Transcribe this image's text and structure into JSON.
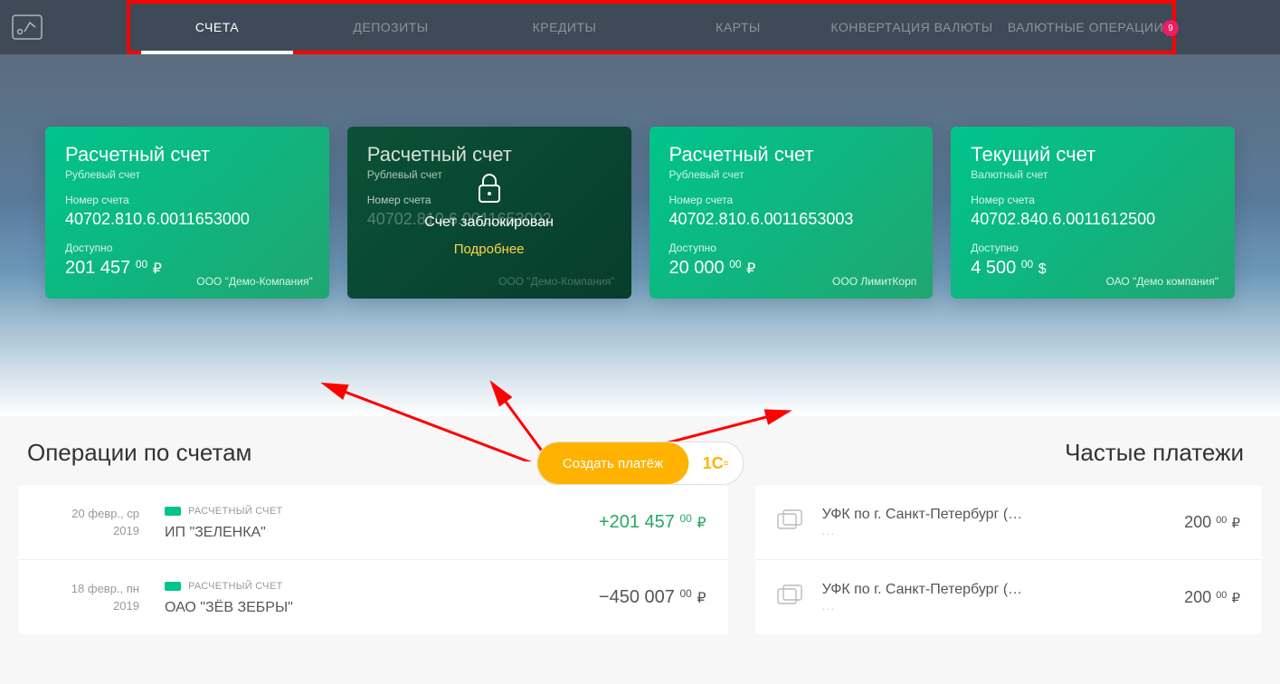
{
  "nav": {
    "items": [
      "СЧЕТА",
      "ДЕПОЗИТЫ",
      "КРЕДИТЫ",
      "КАРТЫ",
      "КОНВЕРТАЦИЯ ВАЛЮТЫ",
      "ВАЛЮТНЫЕ ОПЕРАЦИИ"
    ],
    "active_index": 0,
    "badge": "9"
  },
  "accounts": [
    {
      "title": "Расчетный счет",
      "subtitle": "Рублевый счет",
      "number_label": "Номер счета",
      "number": "40702.810.6.0011653000",
      "available_label": "Доступно",
      "amount": "201 457",
      "cents": "00",
      "currency": "₽",
      "company": "ООО \"Демо-Компания\"",
      "blocked": false
    },
    {
      "title": "Расчетный счет",
      "subtitle": "Рублевый счет",
      "number_label": "Номер счета",
      "number": "40702.810.6.0011653002",
      "blocked": true,
      "blocked_msg": "Счет заблокирован",
      "blocked_more": "Подробнее",
      "company": "ООО \"Демо-Компания\""
    },
    {
      "title": "Расчетный счет",
      "subtitle": "Рублевый счет",
      "number_label": "Номер счета",
      "number": "40702.810.6.0011653003",
      "available_label": "Доступно",
      "amount": "20 000",
      "cents": "00",
      "currency": "₽",
      "company": "ООО ЛимитКорп",
      "blocked": false
    },
    {
      "title": "Текущий счет",
      "subtitle": "Валютный счет",
      "number_label": "Номер счета",
      "number": "40702.840.6.0011612500",
      "available_label": "Доступно",
      "amount": "4 500",
      "cents": "00",
      "currency": "$",
      "company": "ОАО \"Демо компания\"",
      "blocked": false
    }
  ],
  "operations": {
    "title": "Операции по счетам",
    "create_button": "Создать платёж",
    "1c_label": "1C",
    "rows": [
      {
        "date_line1": "20 февр., ср",
        "date_line2": "2019",
        "account_type": "РАСЧЕТНЫЙ СЧЕТ",
        "name": "ИП \"ЗЕЛЕНКА\"",
        "sign": "+",
        "amount": "201 457",
        "cents": "00",
        "currency": "₽",
        "positive": true
      },
      {
        "date_line1": "18 февр., пн",
        "date_line2": "2019",
        "account_type": "РАСЧЕТНЫЙ СЧЕТ",
        "name": "ОАО \"ЗЁВ ЗЕБРЫ\"",
        "sign": "−",
        "amount": "450 007",
        "cents": "00",
        "currency": "₽",
        "positive": false
      }
    ]
  },
  "frequent": {
    "title": "Частые платежи",
    "rows": [
      {
        "name": "УФК по г. Санкт-Петербург (…",
        "sub": "...",
        "amount": "200",
        "cents": "00",
        "currency": "₽"
      },
      {
        "name": "УФК по г. Санкт-Петербург (…",
        "sub": "...",
        "amount": "200",
        "cents": "00",
        "currency": "₽"
      }
    ]
  }
}
